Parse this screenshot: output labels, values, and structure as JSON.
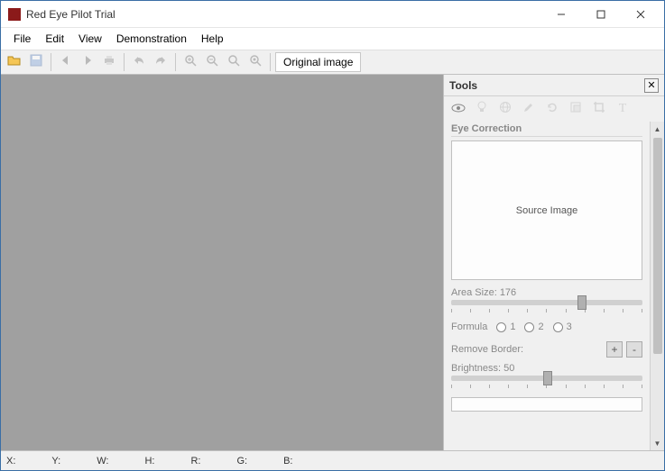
{
  "window": {
    "title": "Red Eye Pilot Trial"
  },
  "menu": {
    "file": "File",
    "edit": "Edit",
    "view": "View",
    "demo": "Demonstration",
    "help": "Help"
  },
  "toolbar": {
    "original_image": "Original image"
  },
  "tools": {
    "title": "Tools",
    "section": "Eye Correction",
    "source_caption": "Source Image",
    "area_size_label": "Area Size:",
    "area_size_value": "176",
    "formula_label": "Formula",
    "formula_opts": {
      "a": "1",
      "b": "2",
      "c": "3"
    },
    "remove_border_label": "Remove Border:",
    "brightness_label": "Brightness:",
    "brightness_value": "50"
  },
  "status": {
    "x": "X:",
    "y": "Y:",
    "w": "W:",
    "h": "H:",
    "r": "R:",
    "g": "G:",
    "b": "B:"
  }
}
